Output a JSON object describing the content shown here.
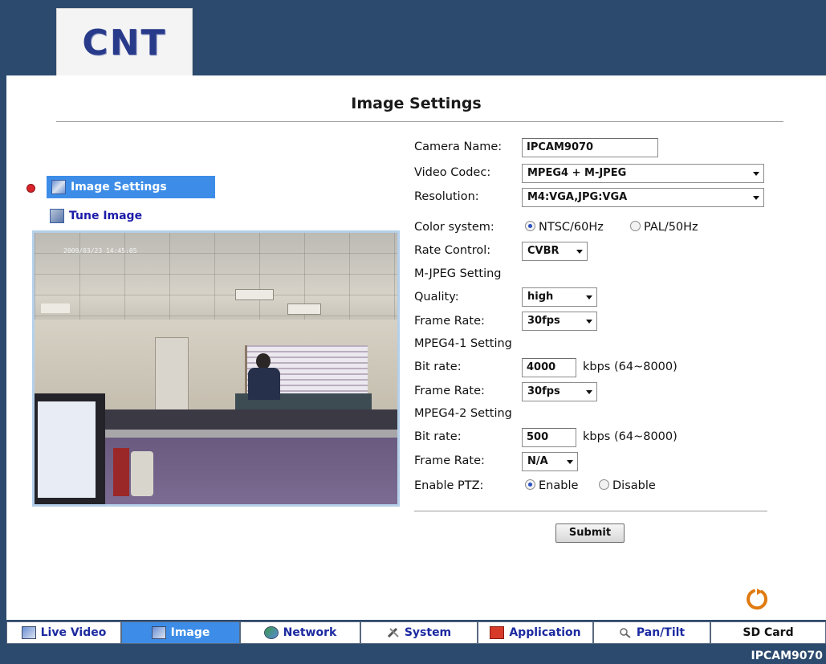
{
  "header": {
    "logo_text": "CNT"
  },
  "page": {
    "title": "Image Settings"
  },
  "sidebar": {
    "items": [
      {
        "label": "Image Settings",
        "active": true
      },
      {
        "label": "Tune Image",
        "active": false
      }
    ]
  },
  "preview": {
    "timestamp": "2009/03/23 14:45:05"
  },
  "form": {
    "camera_name": {
      "label": "Camera Name:",
      "value": "IPCAM9070"
    },
    "video_codec": {
      "label": "Video Codec:",
      "value": "MPEG4 + M-JPEG"
    },
    "resolution": {
      "label": "Resolution:",
      "value": "M4:VGA,JPG:VGA"
    },
    "color_system": {
      "label": "Color system:",
      "option1": "NTSC/60Hz",
      "option2": "PAL/50Hz",
      "selected": "NTSC/60Hz"
    },
    "rate_control": {
      "label": "Rate Control:",
      "value": "CVBR"
    },
    "mjpeg_section": "M-JPEG Setting",
    "mjpeg_quality": {
      "label": "Quality:",
      "value": "high"
    },
    "mjpeg_frame_rate": {
      "label": "Frame Rate:",
      "value": "30fps"
    },
    "mpeg4_1_section": "MPEG4-1 Setting",
    "mpeg4_1_bitrate": {
      "label": "Bit rate:",
      "value": "4000",
      "unit": "kbps (64~8000)"
    },
    "mpeg4_1_frame_rate": {
      "label": "Frame Rate:",
      "value": "30fps"
    },
    "mpeg4_2_section": "MPEG4-2 Setting",
    "mpeg4_2_bitrate": {
      "label": "Bit rate:",
      "value": "500",
      "unit": "kbps (64~8000)"
    },
    "mpeg4_2_frame_rate": {
      "label": "Frame Rate:",
      "value": "N/A"
    },
    "enable_ptz": {
      "label": "Enable PTZ:",
      "option1": "Enable",
      "option2": "Disable",
      "selected": "Enable"
    },
    "submit_label": "Submit"
  },
  "tabs": [
    {
      "label": "Live Video",
      "active": false
    },
    {
      "label": "Image",
      "active": true
    },
    {
      "label": "Network",
      "active": false
    },
    {
      "label": "System",
      "active": false
    },
    {
      "label": "Application",
      "active": false
    },
    {
      "label": "Pan/Tilt",
      "active": false
    },
    {
      "label": "SD Card",
      "active": false
    }
  ],
  "footer": {
    "model": "IPCAM9070"
  },
  "colors": {
    "frame": "#2c4a6e",
    "active_tab": "#3d8de8",
    "link": "#1c1ca8",
    "refresh_icon": "#e07a10"
  }
}
